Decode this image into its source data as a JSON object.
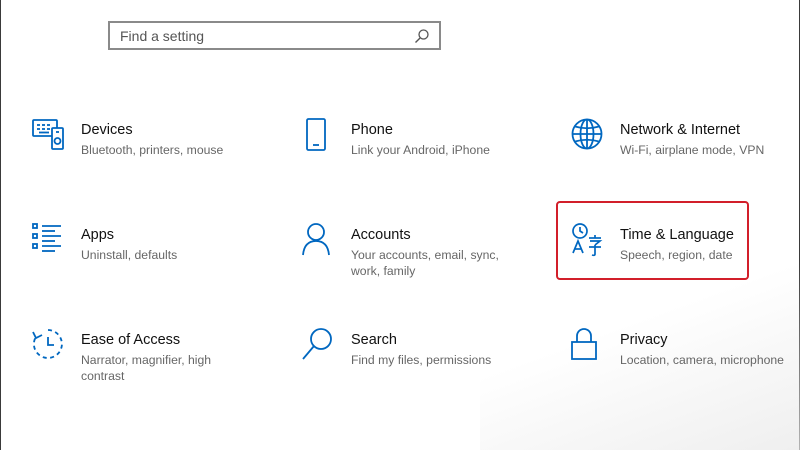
{
  "search": {
    "placeholder": "Find a setting",
    "icon": "search-icon"
  },
  "accent_color": "#0067c0",
  "highlight_color": "#d21f2a",
  "tiles": [
    {
      "title": "Devices",
      "desc": "Bluetooth, printers, mouse",
      "icon": "devices-icon"
    },
    {
      "title": "Phone",
      "desc": "Link your Android, iPhone",
      "icon": "phone-icon"
    },
    {
      "title": "Network & Internet",
      "desc": "Wi-Fi, airplane mode, VPN",
      "icon": "globe-icon"
    },
    {
      "title": "Apps",
      "desc": "Uninstall, defaults",
      "icon": "apps-list-icon"
    },
    {
      "title": "Accounts",
      "desc": "Your accounts, email, sync, work, family",
      "icon": "person-icon"
    },
    {
      "title": "Time & Language",
      "desc": "Speech, region, date",
      "icon": "time-language-icon"
    },
    {
      "title": "Ease of Access",
      "desc": "Narrator, magnifier, high contrast",
      "icon": "ease-of-access-icon"
    },
    {
      "title": "Search",
      "desc": "Find my files, permissions",
      "icon": "search-icon"
    },
    {
      "title": "Privacy",
      "desc": "Location, camera, microphone",
      "icon": "lock-icon"
    }
  ]
}
